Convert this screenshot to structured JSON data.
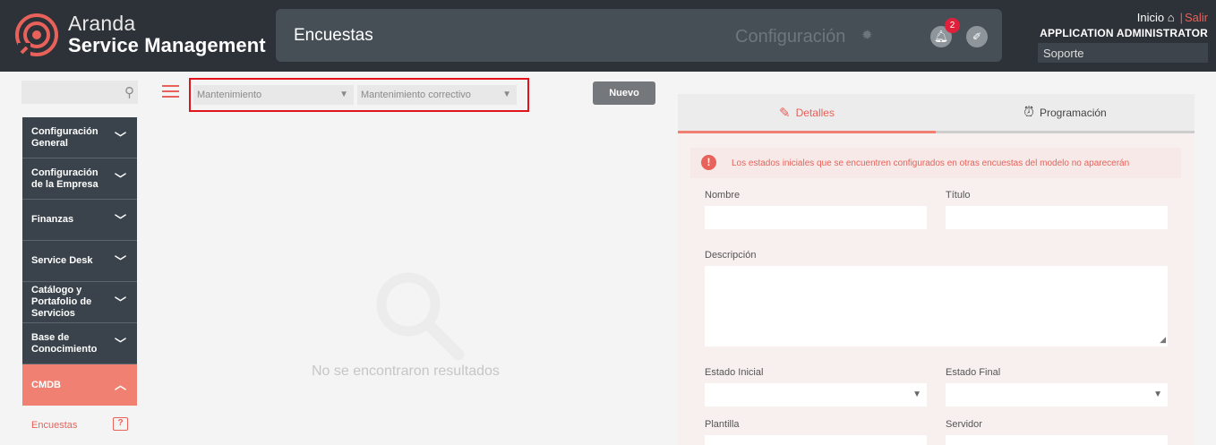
{
  "header": {
    "brand_line1": "Aranda",
    "brand_line2": "Service Management",
    "module_title": "Encuestas",
    "config_label": "Configuración",
    "notifications_count": "2",
    "home_link": "Inicio",
    "logout_link": "Salir",
    "separator": "|",
    "user_name": "APPLICATION ADMINISTRATOR",
    "project": "Soporte"
  },
  "sidebar": {
    "search_placeholder": "",
    "items": [
      {
        "label": "Configuración General"
      },
      {
        "label": "Configuración de la Empresa"
      },
      {
        "label": "Finanzas"
      },
      {
        "label": "Service Desk"
      },
      {
        "label": "Catálogo y Portafolio de Servicios"
      },
      {
        "label": "Base de Conocimiento"
      },
      {
        "label": "CMDB"
      }
    ],
    "sub_item": "Encuestas"
  },
  "filters": {
    "category": "Mantenimiento",
    "type": "Mantenimiento correctivo",
    "new_button": "Nuevo"
  },
  "results": {
    "empty_message": "No se encontraron resultados"
  },
  "panel": {
    "tabs": [
      {
        "label": "Detalles"
      },
      {
        "label": "Programación"
      }
    ],
    "alert": "Los estados iniciales que se encuentren configurados en otras encuestas del modelo no aparecerán",
    "fields": {
      "nombre": "Nombre",
      "titulo": "Título",
      "descripcion": "Descripción",
      "estado_inicial": "Estado Inicial",
      "estado_final": "Estado Final",
      "plantilla": "Plantilla",
      "servidor": "Servidor"
    }
  },
  "colors": {
    "header_bg": "#2c3238",
    "accent": "#e8615a",
    "sidebar_bg": "#3a434b",
    "active_item": "#ef8072",
    "highlight_border": "#e0141a"
  },
  "icons": {
    "logo": "aranda-logo-icon",
    "gear": "gear-icon",
    "bell": "bell-icon",
    "wand": "magic-wand-icon",
    "home": "home-icon",
    "search": "search-icon",
    "menu": "hamburger-icon",
    "chevron": "chevron-down-icon",
    "question": "question-icon",
    "edit": "edit-icon",
    "alarm": "alarm-clock-icon",
    "alert": "alert-icon"
  }
}
